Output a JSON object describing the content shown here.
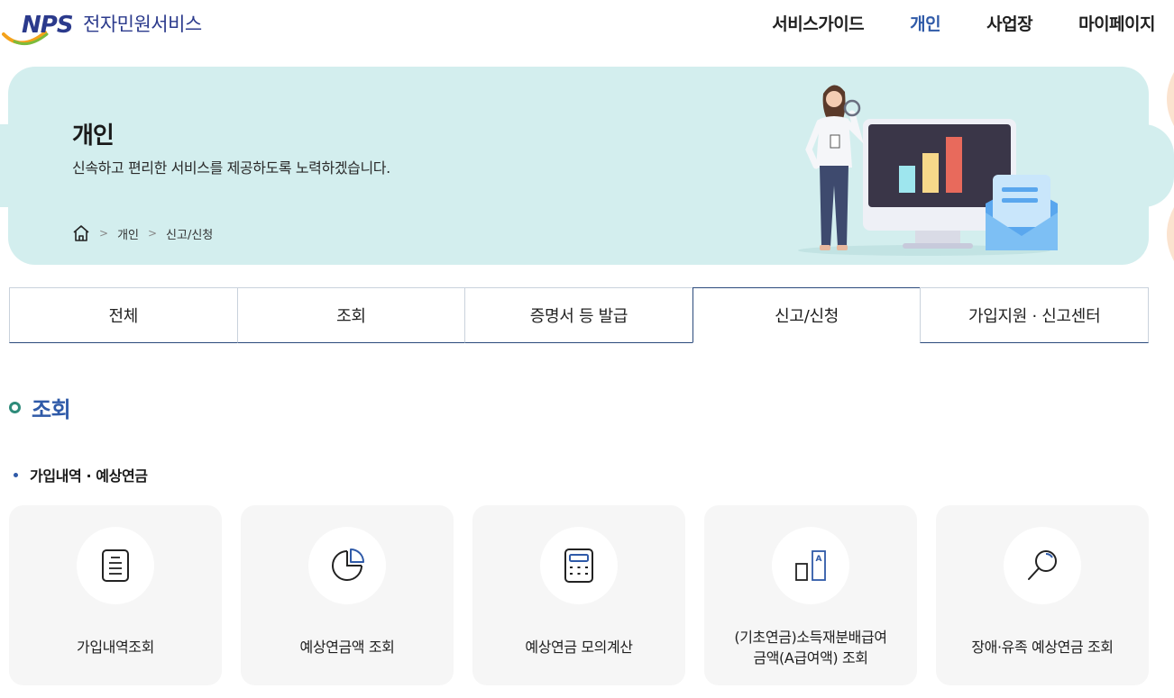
{
  "header": {
    "logo_text": "NPS",
    "service_name": "전자민원서비스",
    "nav": [
      {
        "label": "서비스가이드",
        "active": false
      },
      {
        "label": "개인",
        "active": true
      },
      {
        "label": "사업장",
        "active": false
      },
      {
        "label": "마이페이지",
        "active": false
      }
    ]
  },
  "banner": {
    "title": "개인",
    "subtitle": "신속하고 편리한 서비스를 제공하도록 노력하겠습니다.",
    "breadcrumb": [
      "개인",
      "신고/신청"
    ],
    "home_icon": "home-icon"
  },
  "tabs": [
    {
      "label": "전체",
      "active": false
    },
    {
      "label": "조회",
      "active": false
    },
    {
      "label": "증명서 등 발급",
      "active": false
    },
    {
      "label": "신고/신청",
      "active": true
    },
    {
      "label": "가입지원 · 신고센터",
      "active": false
    }
  ],
  "section": {
    "title": "조회",
    "subsection": "가입내역 · 예상연금"
  },
  "cards": [
    {
      "label": "가입내역조회",
      "icon": "document-icon"
    },
    {
      "label": "예상연금액 조회",
      "icon": "pie-chart-icon"
    },
    {
      "label": "예상연금 모의계산",
      "icon": "calculator-icon"
    },
    {
      "label": "(기초연금)소득재분배급여\n금액(A급여액) 조회",
      "icon": "bar-a-icon"
    },
    {
      "label": "장애·유족 예상연금 조회",
      "icon": "magnifier-icon"
    }
  ],
  "colors": {
    "brand_blue": "#2f5aa8",
    "banner_bg": "#d3eeee",
    "accent_green": "#2e8b7a",
    "card_bg": "#f6f6f6"
  }
}
